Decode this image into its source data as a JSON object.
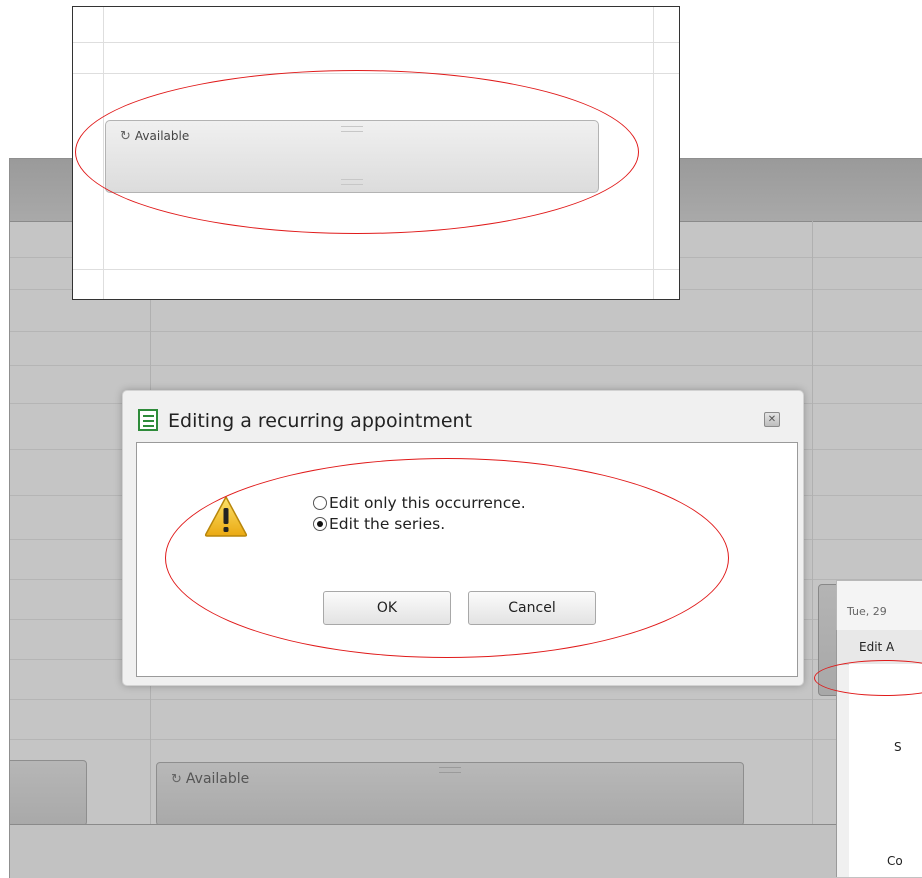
{
  "dialog": {
    "title": "Editing a recurring appointment",
    "close_glyph": "✕",
    "options": [
      {
        "label": "Edit only this occurrence.",
        "selected": false
      },
      {
        "label": "Edit the series.",
        "selected": true
      }
    ],
    "ok_label": "OK",
    "cancel_label": "Cancel"
  },
  "appointments": {
    "zoomed_label": "Available",
    "bottom_label": "Available",
    "recurrence_icon": "↻"
  },
  "side_panel": {
    "date_label": "Tue, 29",
    "tab_label": "Edit A",
    "fragment_1": "S",
    "fragment_2": "Co"
  },
  "colors": {
    "highlight": "#e01a1a",
    "title_icon": "#2e8b3a",
    "warning": "#f4c430"
  }
}
